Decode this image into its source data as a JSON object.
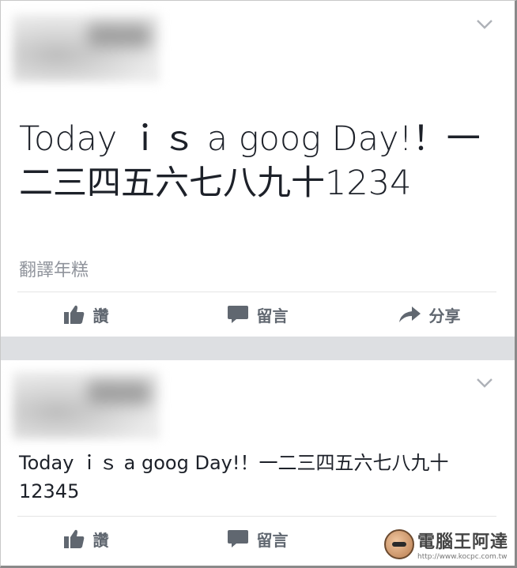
{
  "posts": [
    {
      "text_lines": [
        "Today ｉｓ a goog Day!！一",
        "二三四五六七八九十1234"
      ],
      "translate_label": "翻譯年糕",
      "actions": [
        {
          "label": "讚",
          "icon": "thumbs-up-icon"
        },
        {
          "label": "留言",
          "icon": "comment-icon"
        },
        {
          "label": "分享",
          "icon": "share-icon"
        }
      ]
    },
    {
      "text_lines": [
        "Today ｉｓ a goog Day!！一二三四五六七八九十",
        "12345"
      ],
      "actions": [
        {
          "label": "讚",
          "icon": "thumbs-up-icon"
        },
        {
          "label": "留言",
          "icon": "comment-icon"
        }
      ]
    }
  ],
  "watermark": {
    "main": "電腦王阿達",
    "url": "http://www.kocpc.com.tw"
  },
  "colors": {
    "separator": "#dddfe2",
    "action_gray": "#606770",
    "text": "#1d2129",
    "muted": "#90949c"
  }
}
